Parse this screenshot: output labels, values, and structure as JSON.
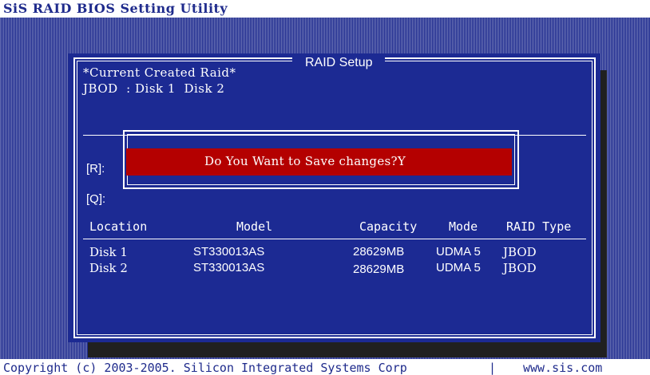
{
  "app": {
    "title": "SiS RAID BIOS Setting Utility"
  },
  "panel": {
    "title": "RAID Setup",
    "current_created_label": "*Current Created Raid*",
    "current_created_value": "JBOD  : Disk 1  Disk 2"
  },
  "keys": {
    "r": "[R]:",
    "q": "[Q]:"
  },
  "dialog": {
    "message": "Do You Want to Save changes?Y"
  },
  "table": {
    "headers": [
      "Location",
      "Model",
      "Capacity",
      "Mode",
      "RAID Type"
    ],
    "rows": [
      {
        "location": "Disk 1",
        "model": "ST330013AS",
        "capacity": "28629MB",
        "mode": "UDMA 5",
        "raid_type": "JBOD"
      },
      {
        "location": "Disk 2",
        "model": "ST330013AS",
        "capacity": "28629MB",
        "mode": "UDMA 5",
        "raid_type": "JBOD"
      }
    ]
  },
  "footer": {
    "copyright": "Copyright (c) 2003-2005. Silicon Integrated Systems Corp",
    "separator": "|",
    "url": "www.sis.com"
  },
  "colors": {
    "background_blue": "#1c2a93",
    "dialog_red": "#b40000",
    "text_white": "#ffffff",
    "title_text": "#1f2b8c"
  }
}
